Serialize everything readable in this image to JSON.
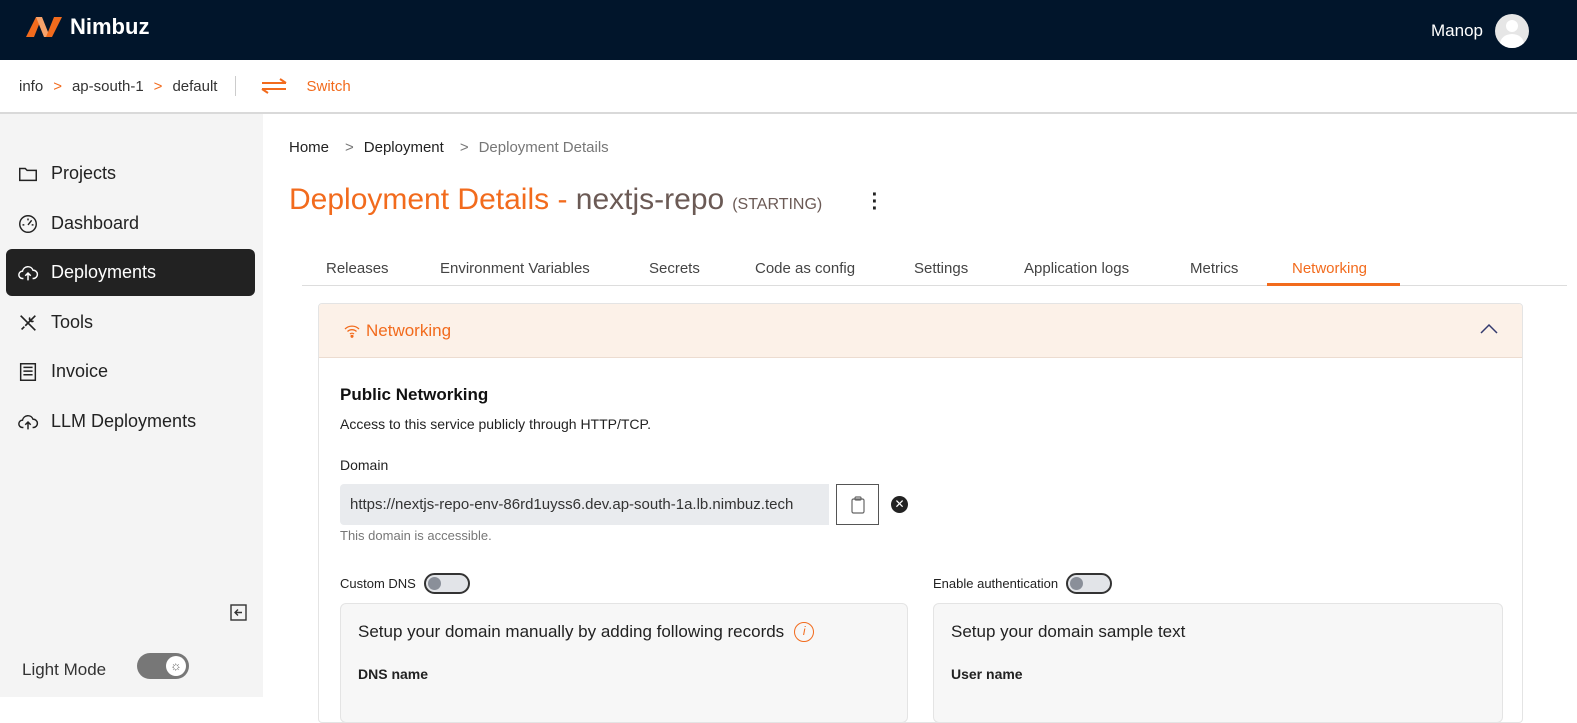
{
  "app": {
    "name": "Nimbuz",
    "user": "Manop"
  },
  "context": {
    "items": [
      "info",
      "ap-south-1",
      "default"
    ],
    "separator": ">",
    "switch_label": "Switch"
  },
  "sidebar": {
    "items": [
      {
        "label": "Projects",
        "icon": "folder-icon"
      },
      {
        "label": "Dashboard",
        "icon": "gauge-icon"
      },
      {
        "label": "Deployments",
        "icon": "cloud-upload-icon",
        "active": true
      },
      {
        "label": "Tools",
        "icon": "tools-icon"
      },
      {
        "label": "Invoice",
        "icon": "invoice-icon"
      },
      {
        "label": "LLM Deployments",
        "icon": "cloud-upload-icon"
      }
    ],
    "light_mode_label": "Light Mode"
  },
  "breadcrumb": {
    "items": [
      "Home",
      "Deployment",
      "Deployment Details"
    ],
    "separator": ">"
  },
  "title": {
    "prefix": "Deployment Details - ",
    "name": "nextjs-repo",
    "status": "(STARTING)"
  },
  "tabs": [
    "Releases",
    "Environment Variables",
    "Secrets",
    "Code as config",
    "Settings",
    "Application logs",
    "Metrics",
    "Networking"
  ],
  "active_tab": "Networking",
  "networking": {
    "header": "Networking",
    "public_title": "Public Networking",
    "public_desc": "Access to this service publicly through HTTP/TCP.",
    "domain_label": "Domain",
    "domain_value": "https://nextjs-repo-env-86rd1uyss6.dev.ap-south-1a.lb.nimbuz.tech",
    "domain_hint": "This domain is accessible.",
    "custom_dns_label": "Custom DNS",
    "custom_dns_on": false,
    "enable_auth_label": "Enable authentication",
    "enable_auth_on": false,
    "dns_box_title": "Setup your domain manually by adding following records",
    "dns_name_label": "DNS name",
    "auth_box_title": "Setup your domain sample text",
    "user_name_label": "User name"
  },
  "colors": {
    "accent": "#f26b1d",
    "topbar": "#01152b"
  }
}
